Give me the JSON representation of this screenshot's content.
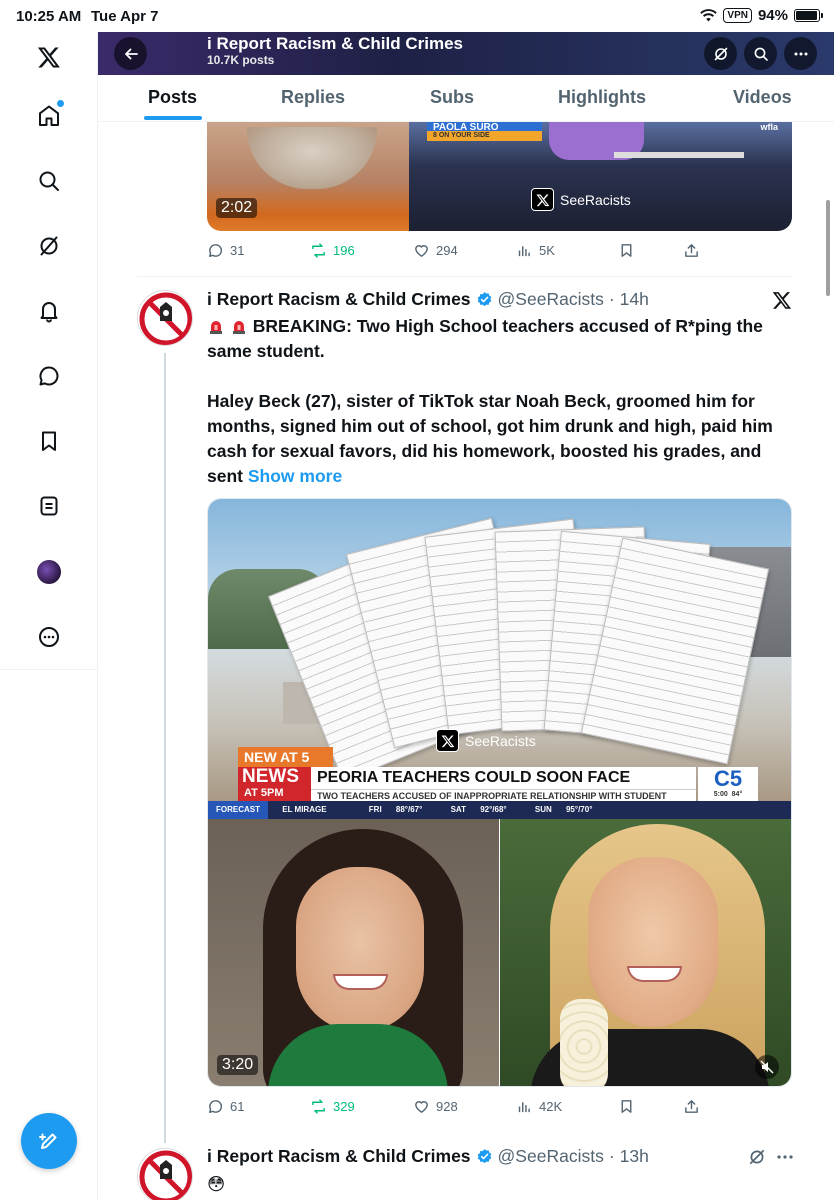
{
  "status_bar": {
    "time": "10:25 AM",
    "date": "Tue Apr 7",
    "vpn": "VPN",
    "battery": "94%",
    "battery_level": 0.94
  },
  "header": {
    "title": "i Report Racism & Child Crimes",
    "post_count": "10.7K posts"
  },
  "tabs": [
    {
      "label": "Posts",
      "active": true
    },
    {
      "label": "Replies",
      "active": false
    },
    {
      "label": "Subs",
      "active": false
    },
    {
      "label": "Highlights",
      "active": false
    },
    {
      "label": "Videos",
      "active": false
    }
  ],
  "nav_icons": [
    "x-logo-icon",
    "home-icon",
    "search-icon",
    "grok-icon",
    "notifications-icon",
    "messages-icon",
    "bookmarks-icon",
    "lists-icon",
    "profile-avatar",
    "more-icon"
  ],
  "prev_tweet": {
    "media_tv_name": "PAOLA SURO",
    "media_tv_tag": "8 ON YOUR SIDE",
    "media_station": "wfla",
    "watermark": "SeeRacists",
    "duration": "2:02",
    "replies": "31",
    "reposts": "196",
    "likes": "294",
    "views": "5K"
  },
  "tweet": {
    "author": "i Report Racism & Child Crimes",
    "handle": "@SeeRacists",
    "time": "14h",
    "headline": "BREAKING: Two High School teachers accused of R*ping the same student.",
    "body": "Haley Beck (27), sister of TikTok star Noah Beck, groomed him for months, signed him out of school, got him drunk and high, paid him cash for sexual favors, did his homework, boosted his grades, and sent",
    "show_more": "Show more",
    "media": {
      "watermark": "SeeRacists",
      "new_at": "NEW AT 5",
      "news": "NEWS",
      "news_time": "AT 5PM",
      "headline": "PEORIA TEACHERS COULD SOON FACE CHARGES",
      "subhead": "TWO TEACHERS ACCUSED OF INAPPROPRIATE RELATIONSHIP WITH STUDENT",
      "channel": "C5",
      "channel_time": "5:00",
      "channel_temp": "84°",
      "forecast": "FORECAST",
      "location": "EL MIRAGE",
      "fri": "FRI",
      "fri_temp": "88°/67°",
      "sat": "SAT",
      "sat_temp": "92°/68°",
      "sun": "SUN",
      "sun_temp": "95°/70°",
      "duration": "3:20"
    },
    "replies": "61",
    "reposts": "329",
    "likes": "928",
    "views": "42K"
  },
  "next_tweet": {
    "author": "i Report Racism & Child Crimes",
    "handle": "@SeeRacists",
    "time": "13h",
    "text": "😳"
  },
  "colors": {
    "accent": "#1d9bf0",
    "repost_green": "#00ba7c",
    "muted": "#536471"
  }
}
